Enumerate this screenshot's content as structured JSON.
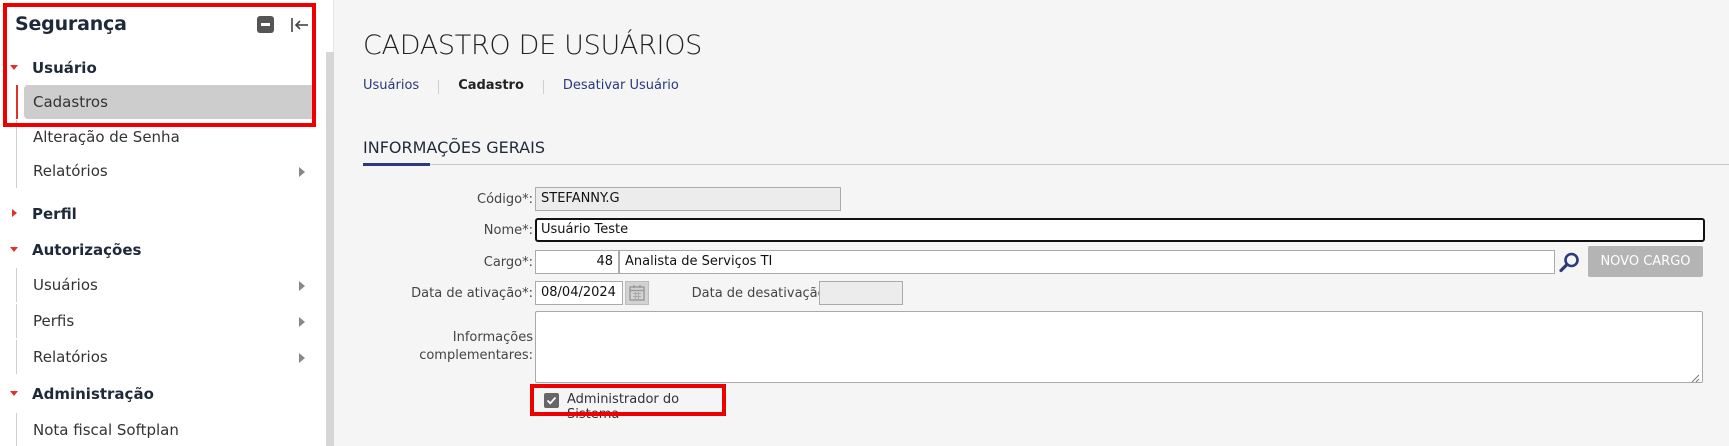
{
  "sidebar": {
    "title": "Segurança",
    "groups": [
      {
        "label": "Usuário",
        "expanded": true,
        "items": [
          {
            "label": "Cadastros",
            "active": true,
            "has_submenu": false
          },
          {
            "label": "Alteração de Senha",
            "active": false,
            "has_submenu": false
          },
          {
            "label": "Relatórios",
            "active": false,
            "has_submenu": true
          }
        ]
      },
      {
        "label": "Perfil",
        "expanded": false,
        "items": []
      },
      {
        "label": "Autorizações",
        "expanded": true,
        "items": [
          {
            "label": "Usuários",
            "has_submenu": true
          },
          {
            "label": "Perfis",
            "has_submenu": true
          },
          {
            "label": "Relatórios",
            "has_submenu": true
          }
        ]
      },
      {
        "label": "Administração",
        "expanded": true,
        "items": [
          {
            "label": "Nota fiscal Softplan",
            "has_submenu": false
          }
        ]
      }
    ],
    "icons": {
      "minimize": "minimize-icon",
      "collapse": "collapse-left-icon",
      "expanded": "caret-down-icon",
      "collapsed": "caret-right-icon",
      "submenu": "chevron-right-icon"
    }
  },
  "main": {
    "title": "CADASTRO DE USUÁRIOS",
    "breadcrumb": [
      {
        "label": "Usuários",
        "current": false
      },
      {
        "label": "Cadastro",
        "current": true
      },
      {
        "label": "Desativar Usuário",
        "current": false
      }
    ],
    "section_title": "INFORMAÇÕES GERAIS",
    "form": {
      "codigo": {
        "label": "Código*:",
        "value": "STEFANNY.G"
      },
      "nome": {
        "label": "Nome*:",
        "value": "Usuário Teste"
      },
      "cargo": {
        "label": "Cargo*:",
        "code": "48",
        "description": "Analista de Serviços TI",
        "new_button": "NOVO CARGO"
      },
      "data_ativacao": {
        "label": "Data de ativação*:",
        "value": "08/04/2024"
      },
      "data_desativacao": {
        "label": "Data de desativação:",
        "value": ""
      },
      "informacoes": {
        "label_line1": "Informações",
        "label_line2": "complementares:",
        "value": ""
      },
      "admin": {
        "label": "Administrador do Sistema",
        "checked": true
      }
    }
  },
  "colors": {
    "accent_red": "#e0322b",
    "highlight_red": "#ee0000",
    "link_blue": "#2a3a7a",
    "active_bg": "#cdcdcd",
    "disabled_button": "#b4b4b4"
  }
}
